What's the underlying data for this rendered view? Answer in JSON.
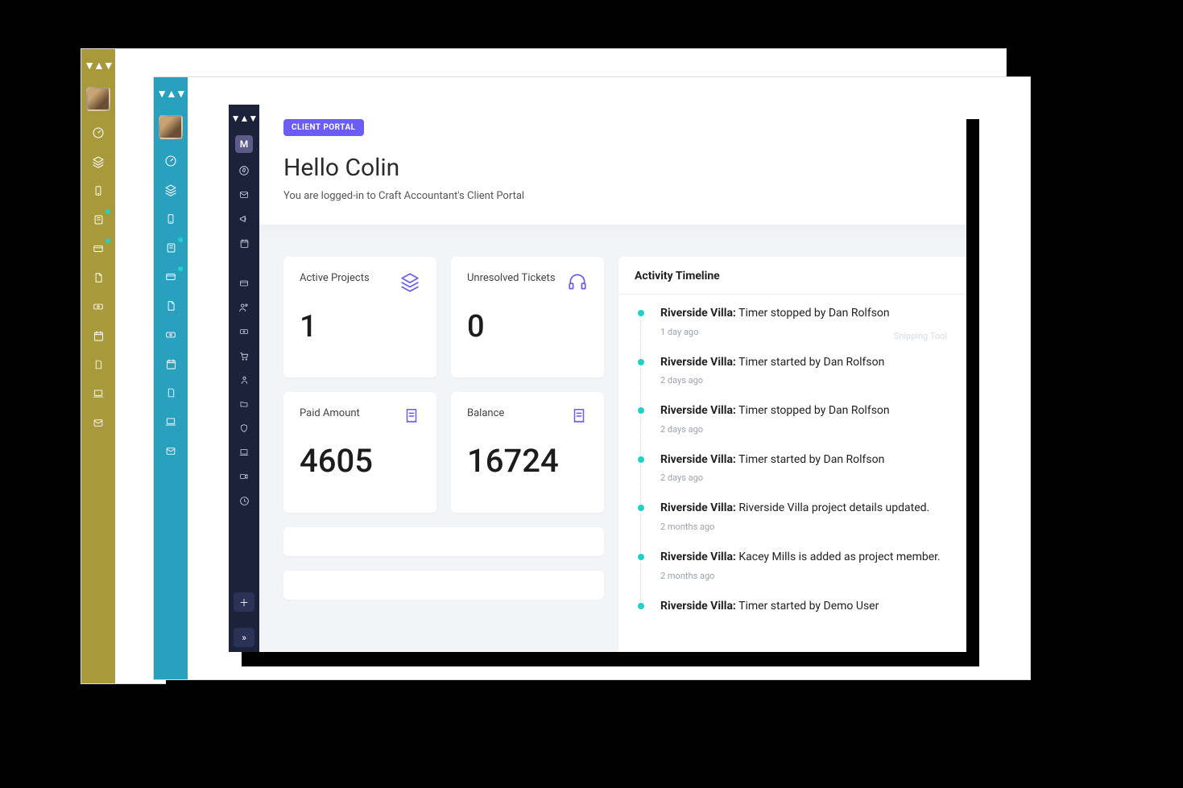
{
  "badge": "CLIENT PORTAL",
  "greeting": "Hello Colin",
  "subtitle": "You are logged-in to Craft Accountant's Client Portal",
  "avatar_letter": "M",
  "ghost_label": "Snipping Tool",
  "stats": {
    "active_projects": {
      "label": "Active Projects",
      "value": "1"
    },
    "unresolved_tickets": {
      "label": "Unresolved Tickets",
      "value": "0"
    },
    "paid_amount": {
      "label": "Paid Amount",
      "value": "4605"
    },
    "balance": {
      "label": "Balance",
      "value": "16724"
    }
  },
  "timeline": {
    "title": "Activity Timeline",
    "items": [
      {
        "project": "Riverside Villa:",
        "text": " Timer stopped by Dan Rolfson",
        "time": "1 day ago"
      },
      {
        "project": "Riverside Villa:",
        "text": " Timer started by Dan Rolfson",
        "time": "2 days ago"
      },
      {
        "project": "Riverside Villa:",
        "text": " Timer stopped by Dan Rolfson",
        "time": "2 days ago"
      },
      {
        "project": "Riverside Villa:",
        "text": " Timer started by Dan Rolfson",
        "time": "2 days ago"
      },
      {
        "project": "Riverside Villa:",
        "text": " Riverside Villa project details updated.",
        "time": "2 months ago"
      },
      {
        "project": "Riverside Villa:",
        "text": " Kacey Mills is added as project member.",
        "time": "2 months ago"
      },
      {
        "project": "Riverside Villa:",
        "text": " Timer started by Demo User",
        "time": ""
      }
    ]
  },
  "side_icons_olive": [
    "gauge",
    "layers",
    "mobile",
    "book",
    "card",
    "file",
    "cash",
    "calendar",
    "page",
    "laptop",
    "mail"
  ],
  "side_icons_teal": [
    "gauge",
    "layers",
    "mobile",
    "book",
    "card",
    "file",
    "cash",
    "calendar",
    "page",
    "laptop",
    "mail"
  ],
  "dark_icons_top": [
    "compass",
    "mail",
    "horn",
    "calendar2"
  ],
  "dark_icons_mid": [
    "card2",
    "users",
    "cash",
    "cart",
    "person",
    "folder",
    "shield",
    "laptop",
    "video",
    "clock"
  ]
}
